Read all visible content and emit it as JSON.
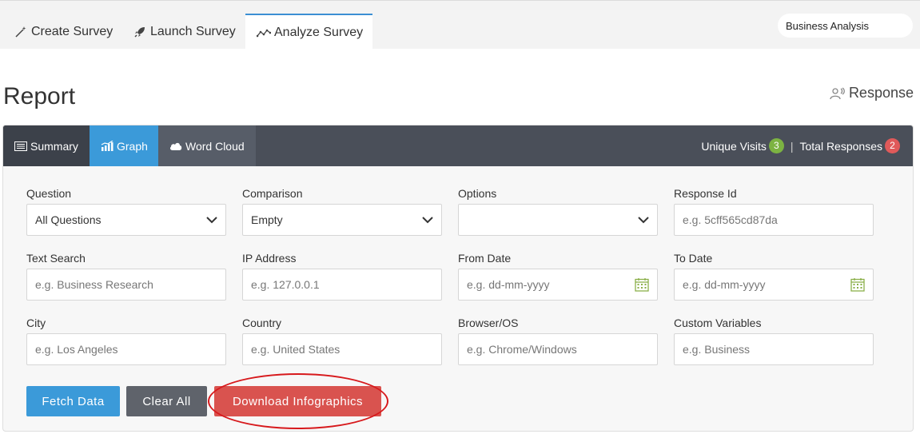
{
  "top_tabs": [
    {
      "label": "Create Survey",
      "icon": "magic-wand-icon"
    },
    {
      "label": "Launch Survey",
      "icon": "rocket-icon"
    },
    {
      "label": "Analyze Survey",
      "icon": "line-chart-icon"
    }
  ],
  "project_selector": {
    "value": "Business Analysis"
  },
  "page": {
    "title": "Report",
    "response_link": "Response"
  },
  "panel_tabs": [
    {
      "label": "Summary",
      "icon": "list-icon"
    },
    {
      "label": "Graph",
      "icon": "bar-chart-icon"
    },
    {
      "label": "Word Cloud",
      "icon": "cloud-icon"
    }
  ],
  "stats": {
    "unique_visits_label": "Unique Visits",
    "unique_visits_count": "3",
    "total_responses_label": "Total Responses",
    "total_responses_count": "2",
    "separator": "|"
  },
  "filters": {
    "question": {
      "label": "Question",
      "value": "All Questions"
    },
    "comparison": {
      "label": "Comparison",
      "value": "Empty"
    },
    "options": {
      "label": "Options",
      "value": ""
    },
    "response_id": {
      "label": "Response Id",
      "placeholder": "e.g. 5cff565cd87da"
    },
    "text_search": {
      "label": "Text Search",
      "placeholder": "e.g. Business Research"
    },
    "ip_address": {
      "label": "IP Address",
      "placeholder": "e.g. 127.0.0.1"
    },
    "from_date": {
      "label": "From Date",
      "placeholder": "e.g. dd-mm-yyyy"
    },
    "to_date": {
      "label": "To Date",
      "placeholder": "e.g. dd-mm-yyyy"
    },
    "city": {
      "label": "City",
      "placeholder": "e.g. Los Angeles"
    },
    "country": {
      "label": "Country",
      "placeholder": "e.g. United States"
    },
    "browser_os": {
      "label": "Browser/OS",
      "placeholder": "e.g. Chrome/Windows"
    },
    "custom_variables": {
      "label": "Custom Variables",
      "placeholder": "e.g. Business"
    }
  },
  "buttons": {
    "fetch": "Fetch Data",
    "clear": "Clear All",
    "download": "Download Infographics"
  },
  "colors": {
    "accent": "#3b9ad9",
    "danger": "#d9534f",
    "header_dark": "#4a4f59",
    "highlight": "#d7191c"
  }
}
